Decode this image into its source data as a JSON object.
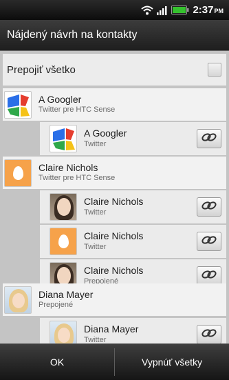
{
  "status_bar": {
    "time": "2:37",
    "ampm": "PM"
  },
  "dialog": {
    "title": "Nájdený návrh na kontakty"
  },
  "relink_all": {
    "label": "Prepojiť všetko",
    "checked": false
  },
  "groups": [
    {
      "name": "A Googler",
      "sub": "Twitter pre HTC Sense",
      "avatar": "google-logo",
      "children": [
        {
          "name": "A Googler",
          "sub": "Twitter",
          "avatar": "google-logo",
          "link_icon": "link-icon"
        }
      ]
    },
    {
      "name": "Claire Nichols",
      "sub": "Twitter pre HTC Sense",
      "avatar": "egg",
      "children": [
        {
          "name": "Claire Nichols",
          "sub": "Twitter",
          "avatar": "woman-photo",
          "link_icon": "link-icon"
        },
        {
          "name": "Claire Nichols",
          "sub": "Twitter",
          "avatar": "egg",
          "link_icon": "link-icon"
        },
        {
          "name": "Claire Nichols",
          "sub": "Prepojené",
          "avatar": "woman-photo",
          "link_icon": "link-icon"
        }
      ]
    },
    {
      "name": "Diana Mayer",
      "sub": "Prepojené",
      "avatar": "blonde-photo",
      "children": [
        {
          "name": "Diana Mayer",
          "sub": "Twitter",
          "avatar": "blonde-photo",
          "link_icon": "link-icon"
        }
      ]
    }
  ],
  "buttons": {
    "ok": "OK",
    "disable_all": "Vypnúť všetky"
  },
  "colors": {
    "egg_avatar": "#f6a24a",
    "list_bg": "#efefef",
    "bar_bg": "#1e1e1e"
  }
}
